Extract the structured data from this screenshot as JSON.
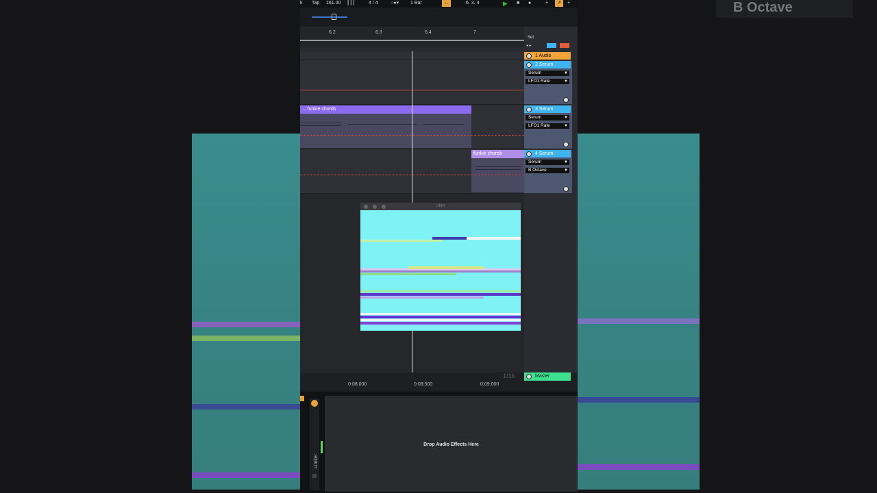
{
  "transport": {
    "left_label": "k",
    "tap": "Tap",
    "bpm": "161.00",
    "signature": "4 / 4",
    "quantize": "1 Bar",
    "position": "6.  3.  4"
  },
  "ruler": {
    "ticks": [
      "6.2",
      "6.3",
      "6.4",
      "7"
    ]
  },
  "arrangement": {
    "clips": [
      {
        "label": "... funkie chords",
        "color": "#8b6cf0"
      },
      {
        "label": "funkie chords",
        "color": "#b08de6"
      }
    ]
  },
  "mixer": {
    "set_label": "Set",
    "tracks": [
      {
        "name": "1 Audio",
        "color": "#f2a33a"
      },
      {
        "name": "2 Serum",
        "color": "#3fb4ef",
        "device": "Serum",
        "param": "LFO1 Rate"
      },
      {
        "name": "3 Serum",
        "color": "#3fb4ef",
        "device": "Serum",
        "param": "LFO1 Rate"
      },
      {
        "name": "4 Serum",
        "color": "#3fb4ef",
        "device": "Serum",
        "param": "B Octave"
      }
    ],
    "master": {
      "name": "Master",
      "color": "#3ce08e"
    }
  },
  "plugin_window": {
    "title": "rthm"
  },
  "timeline": {
    "times": [
      "0:08:000",
      "0:08:500",
      "0:09:000"
    ],
    "zoom": "1/16"
  },
  "device_view": {
    "drop_hint": "Drop Audio Effects Here",
    "limiter_label": "Limiter"
  },
  "background": {
    "ghost_text": "B Octave"
  }
}
